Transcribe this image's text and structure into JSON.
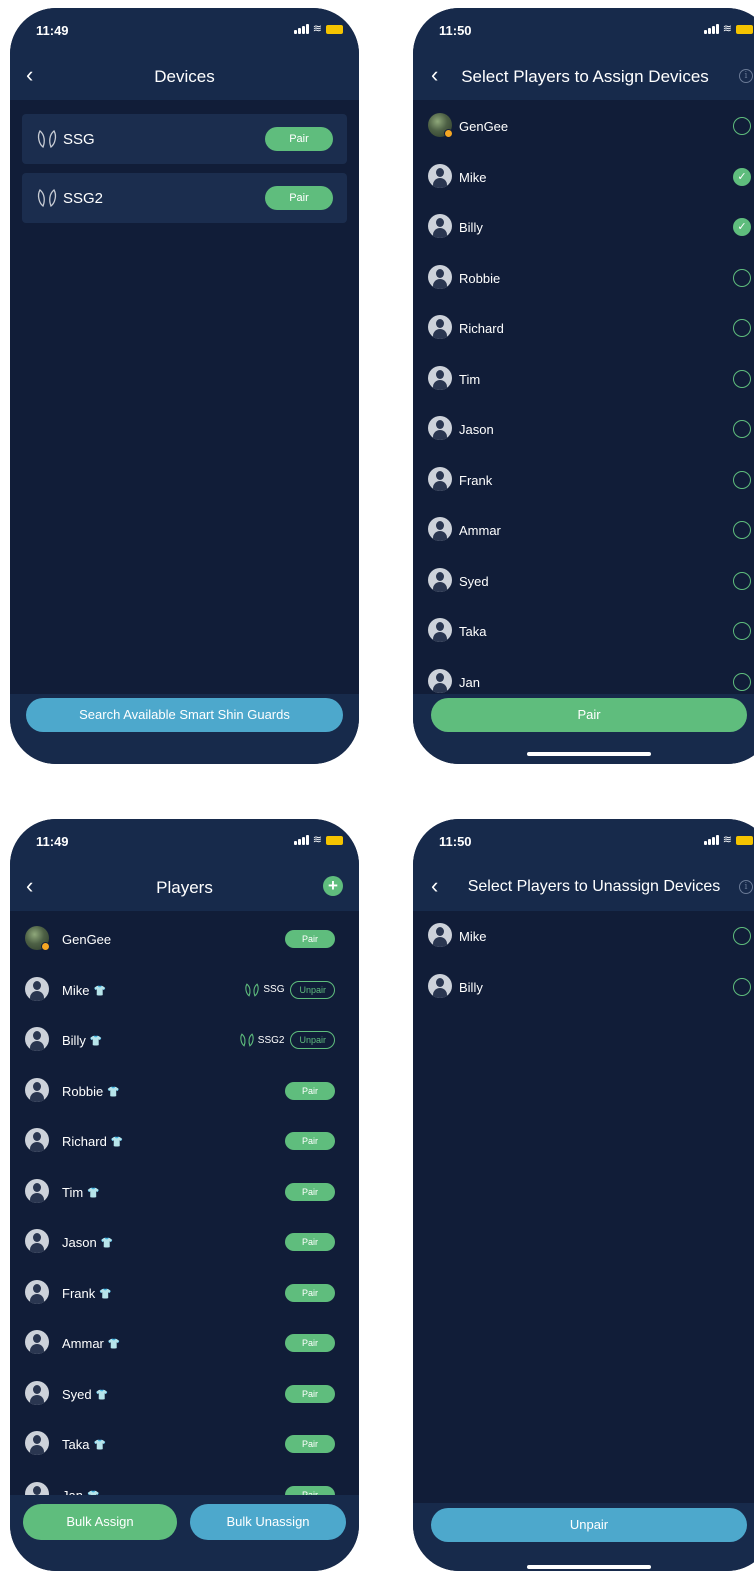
{
  "devices_screen": {
    "time": "11:49",
    "title": "Devices",
    "devices": [
      {
        "name": "SSG",
        "action": "Pair"
      },
      {
        "name": "SSG2",
        "action": "Pair"
      }
    ],
    "search_button": "Search Available Smart Shin Guards"
  },
  "assign_screen": {
    "time": "11:50",
    "title": "Select Players to Assign Devices",
    "players": [
      {
        "name": "GenGee",
        "checked": false
      },
      {
        "name": "Mike",
        "checked": true
      },
      {
        "name": "Billy",
        "checked": true
      },
      {
        "name": "Robbie",
        "checked": false
      },
      {
        "name": "Richard",
        "checked": false
      },
      {
        "name": "Tim",
        "checked": false
      },
      {
        "name": "Jason",
        "checked": false
      },
      {
        "name": "Frank",
        "checked": false
      },
      {
        "name": "Ammar",
        "checked": false
      },
      {
        "name": "Syed",
        "checked": false
      },
      {
        "name": "Taka",
        "checked": false
      },
      {
        "name": "Jan",
        "checked": false
      }
    ],
    "pair_button": "Pair"
  },
  "players_screen": {
    "time": "11:49",
    "title": "Players",
    "players": [
      {
        "name": "GenGee",
        "action": "Pair"
      },
      {
        "name": "Mike",
        "device": "SSG",
        "action": "Unpair"
      },
      {
        "name": "Billy",
        "device": "SSG2",
        "action": "Unpair"
      },
      {
        "name": "Robbie",
        "action": "Pair"
      },
      {
        "name": "Richard",
        "action": "Pair"
      },
      {
        "name": "Tim",
        "action": "Pair"
      },
      {
        "name": "Jason",
        "action": "Pair"
      },
      {
        "name": "Frank",
        "action": "Pair"
      },
      {
        "name": "Ammar",
        "action": "Pair"
      },
      {
        "name": "Syed",
        "action": "Pair"
      },
      {
        "name": "Taka",
        "action": "Pair"
      },
      {
        "name": "Jan",
        "action": "Pair"
      }
    ],
    "bulk_assign": "Bulk Assign",
    "bulk_unassign": "Bulk Unassign"
  },
  "unassign_screen": {
    "time": "11:50",
    "title": "Select Players to Unassign Devices",
    "players": [
      {
        "name": "Mike",
        "checked": false
      },
      {
        "name": "Billy",
        "checked": false
      }
    ],
    "unpair_button": "Unpair"
  },
  "colors": {
    "background": "#111d38",
    "header": "#172a4b",
    "accent_green": "#5fbd7d",
    "accent_blue": "#4da8cc"
  },
  "icons": {
    "back": "‹",
    "check": "✓",
    "info": "i",
    "add": "+",
    "wifi": "≋",
    "jersey": "👕"
  }
}
